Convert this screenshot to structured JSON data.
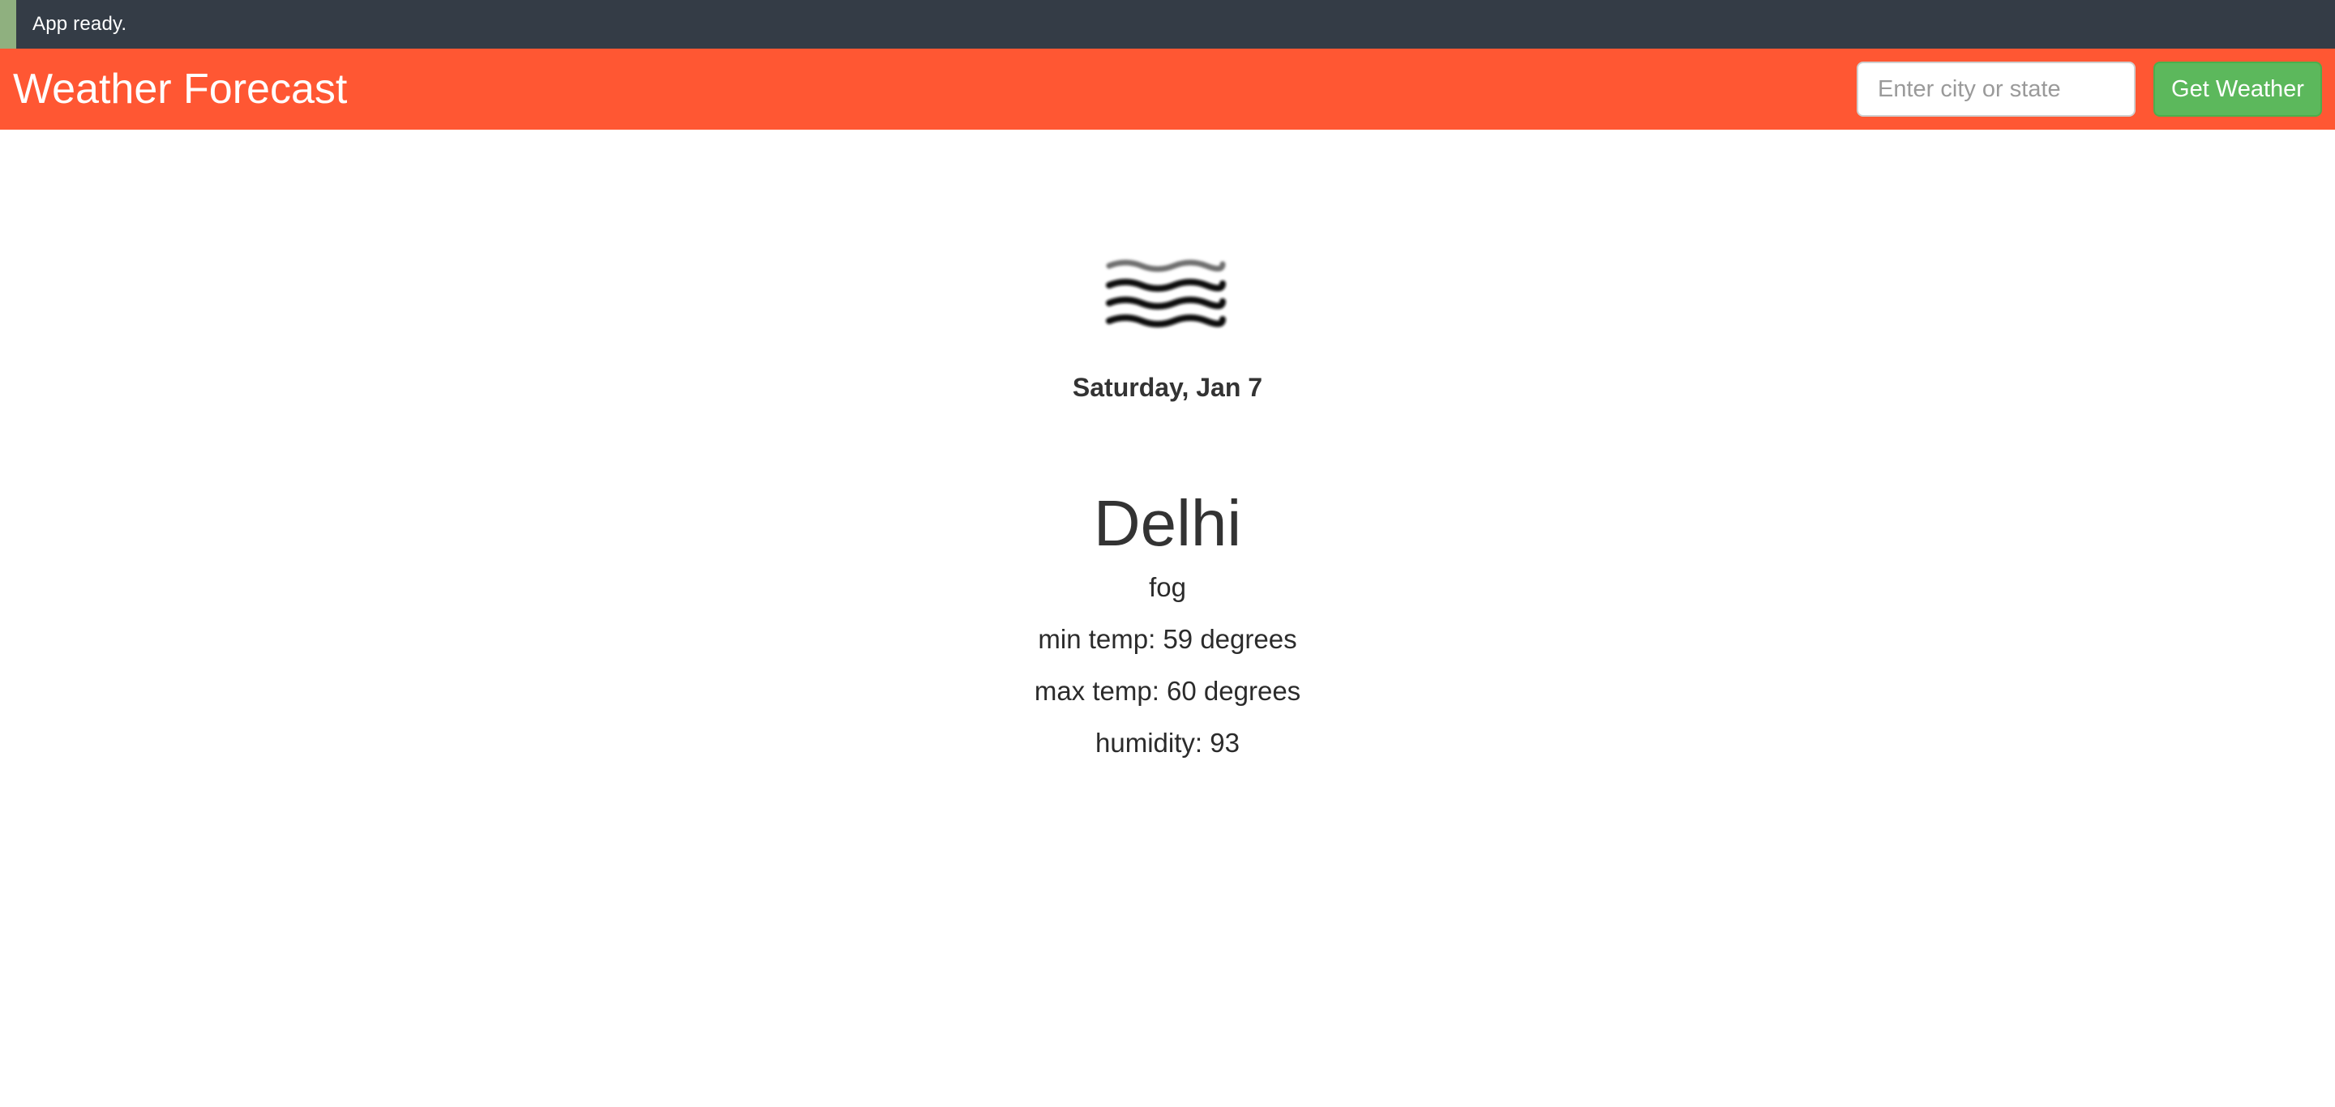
{
  "status": {
    "message": "App ready.",
    "accent_color": "#8fb07f"
  },
  "navbar": {
    "title": "Weather Forecast",
    "search_placeholder": "Enter city or state",
    "search_value": "",
    "button_label": "Get Weather",
    "background_color": "#ff5733"
  },
  "forecast": {
    "icon": "fog-icon",
    "date": "Saturday, Jan 7",
    "city": "Delhi",
    "condition": "fog",
    "min_temp": "min temp: 59 degrees",
    "max_temp": "max temp: 60 degrees",
    "humidity": "humidity: 93"
  }
}
